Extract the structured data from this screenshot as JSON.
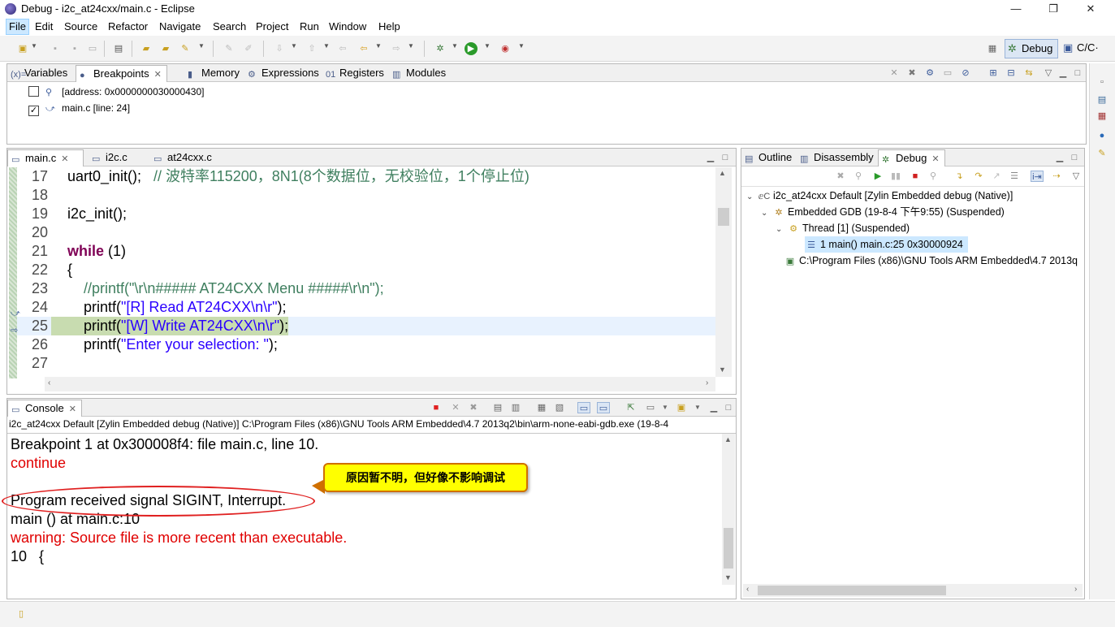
{
  "window": {
    "title": "Debug - i2c_at24cxx/main.c - Eclipse",
    "minimize": "—",
    "restore": "❐",
    "close": "✕"
  },
  "menu": [
    "File",
    "Edit",
    "Source",
    "Refactor",
    "Navigate",
    "Search",
    "Project",
    "Run",
    "Window",
    "Help"
  ],
  "perspectives": {
    "debug": "Debug",
    "cc": "C/C·"
  },
  "top_view": {
    "tabs": [
      "Variables",
      "Breakpoints",
      "Memory",
      "Expressions",
      "Registers",
      "Modules"
    ],
    "active_tab": "Breakpoints",
    "breakpoints": [
      {
        "checked": false,
        "label": "[address: 0x0000000030000430]"
      },
      {
        "checked": true,
        "label": "main.c [line: 24]"
      }
    ]
  },
  "editor": {
    "tabs": [
      "main.c",
      "i2c.c",
      "at24cxx.c"
    ],
    "active_tab": "main.c",
    "lines": [
      {
        "n": "17",
        "code": "uart0_init();",
        "comment": "   // 波特率115200，8N1(8个数据位，无校验位，1个停止位)"
      },
      {
        "n": "18",
        "code": ""
      },
      {
        "n": "19",
        "code": "i2c_init();"
      },
      {
        "n": "20",
        "code": ""
      },
      {
        "n": "21",
        "kw": "while",
        "code": " (1)"
      },
      {
        "n": "22",
        "code": "{"
      },
      {
        "n": "23",
        "comment": "    //printf(\"\\r\\n##### AT24CXX Menu #####\\r\\n\");"
      },
      {
        "n": "24",
        "pre": "    printf(",
        "str": "\"[R] Read AT24CXX\\n\\r\"",
        "post": ");"
      },
      {
        "n": "25",
        "pre": "    printf(",
        "str": "\"[W] Write AT24CXX\\n\\r\"",
        "post": ");"
      },
      {
        "n": "26",
        "pre": "    printf(",
        "str": "\"Enter your selection: \"",
        "post": ");"
      },
      {
        "n": "27",
        "code": ""
      }
    ]
  },
  "debug_view": {
    "tabs": [
      "Outline",
      "Disassembly",
      "Debug"
    ],
    "active_tab": "Debug",
    "tree": [
      "i2c_at24cxx Default [Zylin Embedded debug (Native)]",
      "Embedded GDB (19-8-4 下午9:55) (Suspended)",
      "Thread [1] (Suspended)",
      "1 main() main.c:25 0x30000924",
      "C:\\Program Files (x86)\\GNU Tools ARM Embedded\\4.7 2013q"
    ]
  },
  "console": {
    "tab": "Console",
    "description": "i2c_at24cxx Default [Zylin Embedded debug (Native)] C:\\Program Files (x86)\\GNU Tools ARM Embedded\\4.7 2013q2\\bin\\arm-none-eabi-gdb.exe (19-8-4 ",
    "lines": [
      {
        "text": "Breakpoint 1 at 0x300008f4: file main.c, line 10.",
        "red": false
      },
      {
        "text": "continue",
        "red": true
      },
      {
        "text": "",
        "red": false
      },
      {
        "text": "Program received signal SIGINT, Interrupt.",
        "red": false
      },
      {
        "text": "main () at main.c:10",
        "red": false
      },
      {
        "text": "warning: Source file is more recent than executable.",
        "red": true
      },
      {
        "text": "10   {",
        "red": false
      }
    ]
  },
  "annotation": {
    "callout": "原因暂不明，但好像不影响调试"
  },
  "colors": {
    "keyword": "#7f0055",
    "string": "#2a00ff",
    "comment": "#3f7f5f",
    "console_error": "#e00000",
    "callout_bg": "#ffff00"
  }
}
